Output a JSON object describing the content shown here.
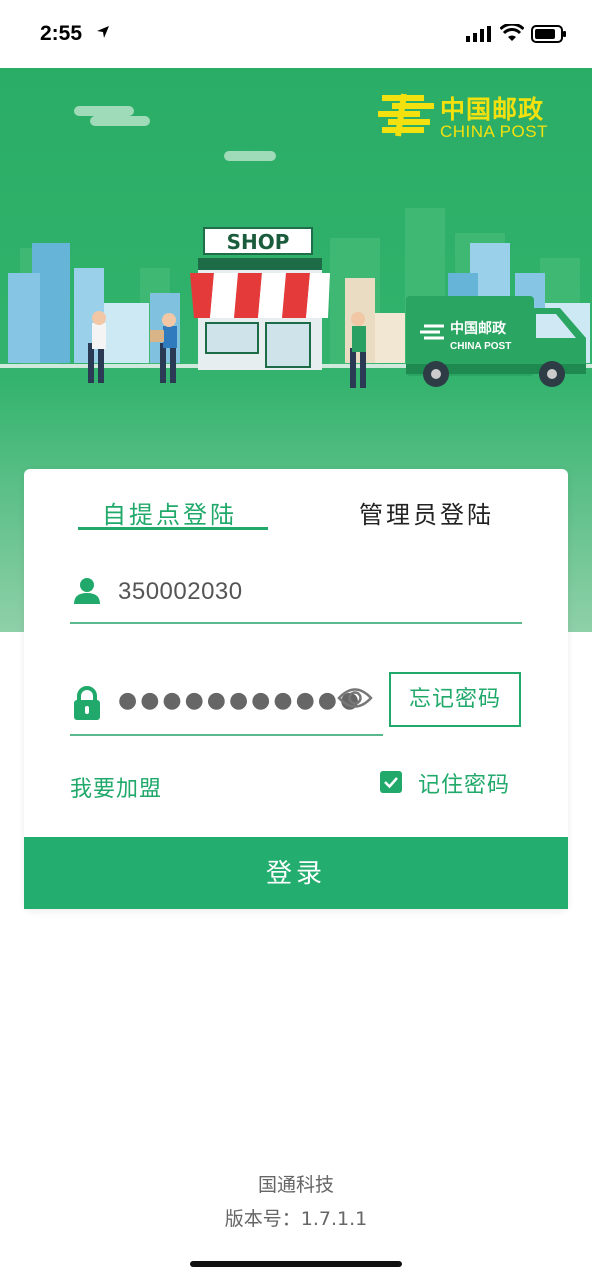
{
  "status_bar": {
    "time": "2:55",
    "icons": [
      "location-arrow-icon",
      "cellular-signal-icon",
      "wifi-icon",
      "battery-icon"
    ]
  },
  "banner": {
    "brand_cn": "中国邮政",
    "brand_en": "CHINA POST",
    "shop_sign": "SHOP",
    "truck_brand_cn": "中国邮政",
    "truck_brand_en": "CHINA POST"
  },
  "login": {
    "tabs": [
      {
        "label": "自提点登陆",
        "active": true
      },
      {
        "label": "管理员登陆",
        "active": false
      }
    ],
    "username": {
      "value": "350002030",
      "icon": "user-icon"
    },
    "password": {
      "masked": "●●●●●●●●●●●",
      "icon": "lock-icon"
    },
    "forgot_label": "忘记密码",
    "join_label": "我要加盟",
    "remember_label": "记住密码",
    "remember_checked": true,
    "submit_label": "登录"
  },
  "footer": {
    "company": "国通科技",
    "version": "版本号：1.7.1.1"
  },
  "colors": {
    "primary_green": "#23ae6f",
    "banner_green": "#2bb068",
    "brand_yellow": "#f2e10e"
  }
}
